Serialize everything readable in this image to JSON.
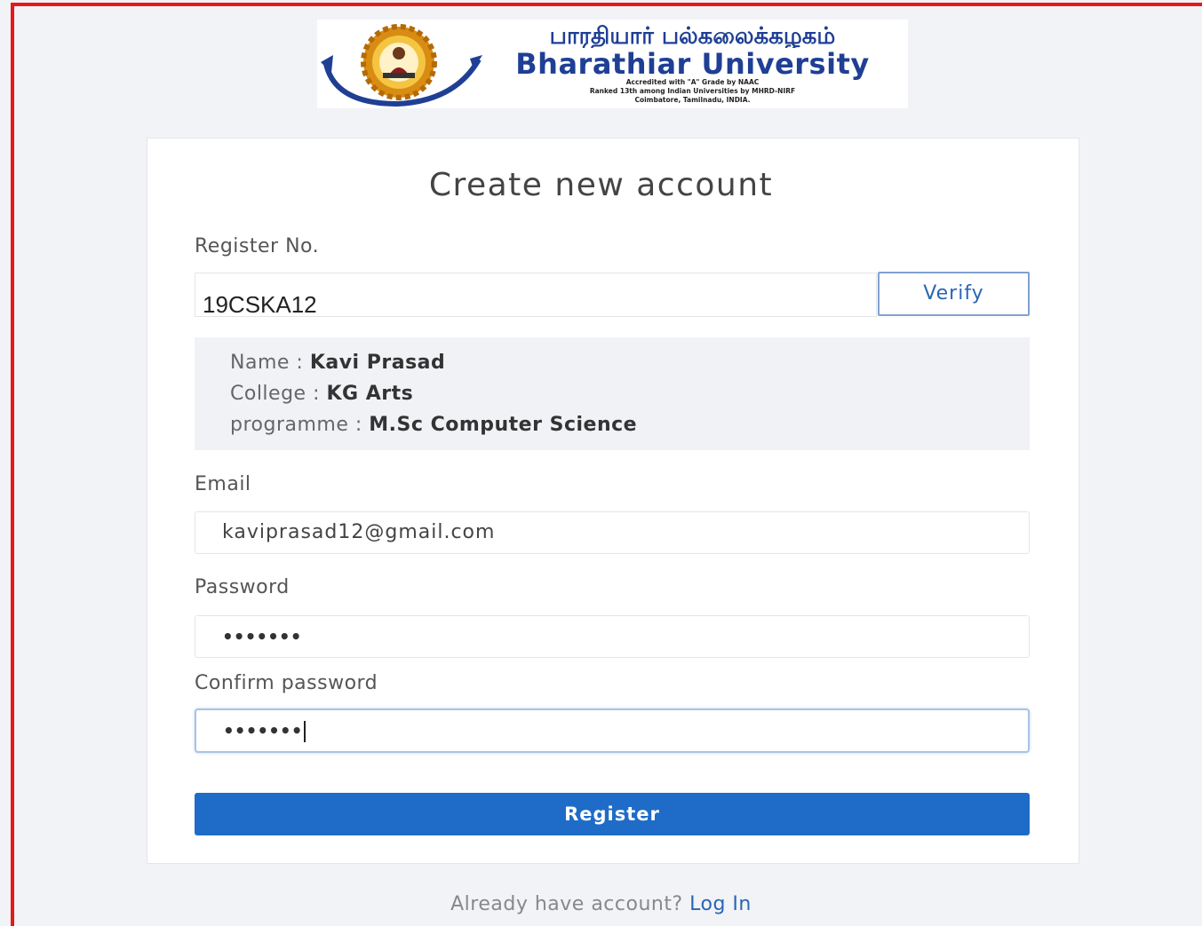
{
  "logo": {
    "tamil_name": "பாரதியார் பல்கலைக்கழகம்",
    "university_name": "Bharathiar University",
    "accreditation": "Accredited with \"A\" Grade by NAAC",
    "ranking": "Ranked 13th among Indian Universities by MHRD-NIRF",
    "location": "Coimbatore, Tamilnadu, INDIA."
  },
  "form": {
    "title": "Create new account",
    "register_no_label": "Register No.",
    "register_no_value": "19CSKA12",
    "verify_label": "Verify",
    "student": {
      "name_label": "Name : ",
      "name_value": "Kavi Prasad",
      "college_label": "College : ",
      "college_value": "KG Arts",
      "programme_label": "programme : ",
      "programme_value": "M.Sc Computer Science"
    },
    "email_label": "Email",
    "email_value": "kaviprasad12@gmail.com",
    "password_label": "Password",
    "password_value": "•••••••",
    "confirm_password_label": "Confirm password",
    "confirm_password_value": "•••••••",
    "register_label": "Register"
  },
  "footer": {
    "prompt": "Already have account? ",
    "login_link": "Log In"
  },
  "colors": {
    "frame_red": "#e41a1a",
    "brand_blue": "#1f3f95",
    "primary_button": "#1e6cc8",
    "link_blue": "#2a65b5"
  }
}
